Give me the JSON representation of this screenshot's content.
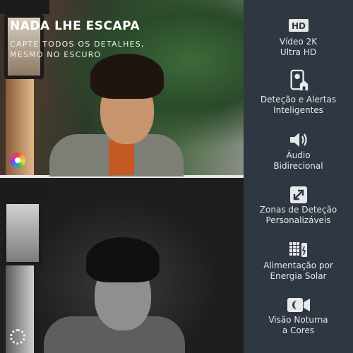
{
  "hero": {
    "headline": "NADA LHE ESCAPA",
    "subline": "CAPTE TODOS OS DETALHES, MESMO NO ESCURO"
  },
  "features": [
    {
      "icon": "hd-icon",
      "line1": "Vídeo 2K",
      "line2": "Ultra HD"
    },
    {
      "icon": "smart-alert-icon",
      "line1": "Deteção e Alertas",
      "line2": "Inteligentes"
    },
    {
      "icon": "speaker-icon",
      "line1": "Áudio",
      "line2": "Bidirecional"
    },
    {
      "icon": "expand-arrow-icon",
      "line1": "Zonas de Deteção",
      "line2": "Personalizáveis"
    },
    {
      "icon": "solar-panel-icon",
      "line1": "Alimentação por",
      "line2": "Energia Solar"
    },
    {
      "icon": "night-camera-icon",
      "line1": "Visão Noturna",
      "line2": "a Cores"
    }
  ],
  "hd_badge": "HD",
  "colors": {
    "panel_bg": "#2f3742",
    "icon_fill": "#e6e8ea",
    "text": "#e6e8ea"
  }
}
